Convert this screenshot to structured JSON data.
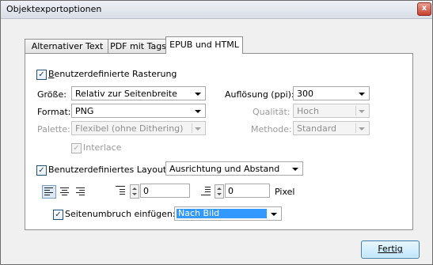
{
  "window": {
    "title": "Objektexportoptionen",
    "close_glyph": "x"
  },
  "tabs": [
    {
      "label": "Alternativer Text",
      "active": false
    },
    {
      "label": "PDF mit Tags",
      "active": false
    },
    {
      "label": "EPUB und HTML",
      "active": true
    }
  ],
  "rasterization": {
    "checkbox_label_pre": "B",
    "checkbox_label_post": "enutzerdefinierte Rasterung",
    "checked": true,
    "size_label": "Größe:",
    "size_value": "Relativ zur Seitenbreite",
    "resolution_label": "Auflösung (ppi):",
    "resolution_value": "300",
    "format_label": "Format:",
    "format_value": "PNG",
    "quality_label": "Qualität:",
    "quality_value": "Hoch",
    "palette_label": "Palette:",
    "palette_value": "Flexibel (ohne Dithering)",
    "method_label": "Methode:",
    "method_value": "Standard",
    "interlace_label": "Interlace",
    "interlace_checked": true
  },
  "layout": {
    "checkbox_label": "Benutzerdefiniertes Layout:",
    "checked": true,
    "layout_value": "Ausrichtung und Abstand",
    "space_before_value": "0",
    "space_after_value": "0",
    "unit_label": "Pixel",
    "pagebreak_label": "Seitenumbruch einfügen:",
    "pagebreak_checked": true,
    "pagebreak_value": "Nach Bild"
  },
  "buttons": {
    "ok_label": "Fertig"
  },
  "colors": {
    "highlight": "#3399ff",
    "button_border": "#3c7fb1"
  }
}
